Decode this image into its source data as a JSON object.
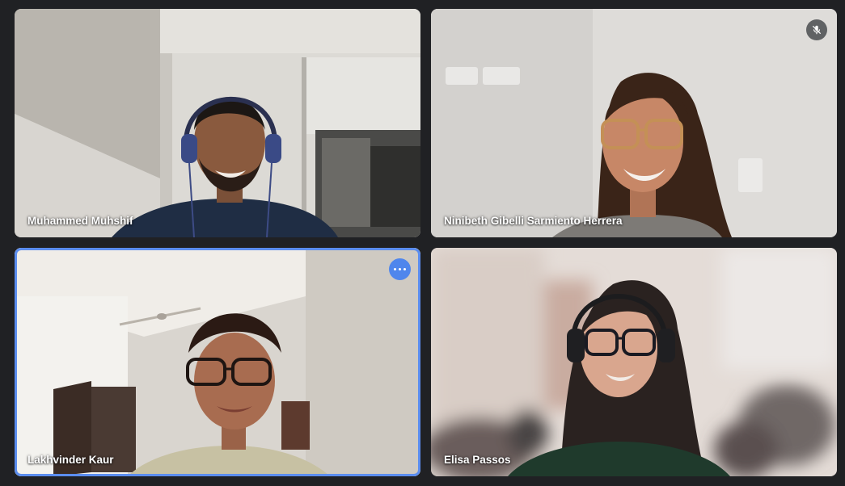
{
  "meeting": {
    "participants": [
      {
        "name": "Muhammed Muhshif",
        "muted": false,
        "active_speaker": false
      },
      {
        "name": "Ninibeth Gibelli Sarmiento Herrera",
        "muted": true,
        "active_speaker": false
      },
      {
        "name": "Lakhvinder Kaur",
        "muted": false,
        "active_speaker": true
      },
      {
        "name": "Elisa Passos",
        "muted": false,
        "active_speaker": false
      }
    ]
  },
  "icons": {
    "mute": "mic-off-icon",
    "more": "more-options-icon"
  },
  "colors": {
    "background": "#202124",
    "active_ring": "#5b8def",
    "more_button": "#4f86ec"
  }
}
